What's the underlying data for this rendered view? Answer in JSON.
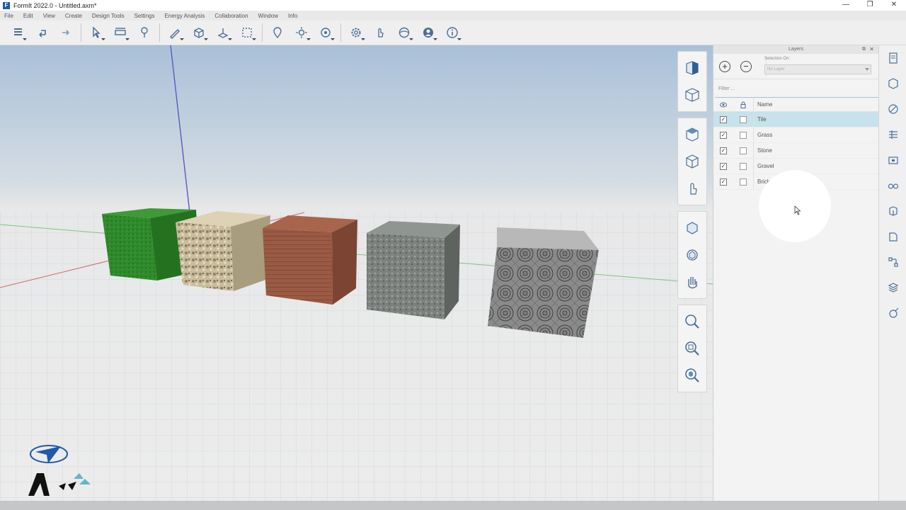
{
  "window": {
    "title": "FormIt 2022.0 - Untitled.axm*",
    "minimize": "—",
    "restore": "❐",
    "close": "✕"
  },
  "menu": [
    "File",
    "Edit",
    "View",
    "Create",
    "Design Tools",
    "Settings",
    "Energy Analysis",
    "Collaboration",
    "Window",
    "Info"
  ],
  "toolbar_icons": [
    "layers-menu-icon",
    "undo-icon",
    "redo-icon",
    "select-icon",
    "measure-icon",
    "paint-icon",
    "draw-icon",
    "solids-icon",
    "modify-icon",
    "group-icon",
    "location-icon",
    "sun-icon",
    "camera-icon",
    "settings-icon",
    "touch-icon",
    "share-icon",
    "user-icon",
    "info-icon"
  ],
  "layers_panel": {
    "title": "Layers",
    "selection_on_label": "Selection On:",
    "selection_on_value": "No Layer",
    "filter_placeholder": "Filter ...",
    "name_header": "Name",
    "rows": [
      {
        "name": "Tile",
        "visible": true,
        "locked": false,
        "selected": true
      },
      {
        "name": "Grass",
        "visible": true,
        "locked": false,
        "selected": false
      },
      {
        "name": "Stone",
        "visible": true,
        "locked": false,
        "selected": false
      },
      {
        "name": "Gravel",
        "visible": true,
        "locked": false,
        "selected": false
      },
      {
        "name": "Brick",
        "visible": true,
        "locked": false,
        "selected": false
      }
    ]
  },
  "colors": {
    "accent": "#1e5aa8",
    "selected_row": "#c6e2ec",
    "grass": "#2d8a2a",
    "brick": "#9a5a44",
    "stone": "#7a807c",
    "tile": "#8c8c8c",
    "gravel": "#cbbf9e"
  }
}
